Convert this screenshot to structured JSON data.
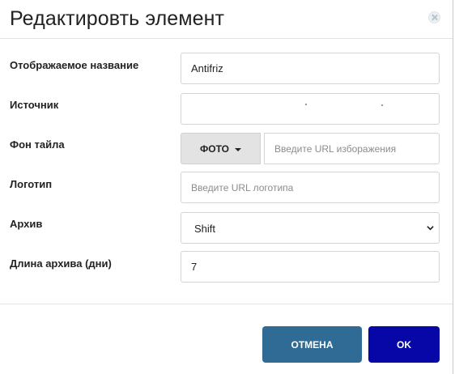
{
  "dialog": {
    "title": "Редактировть элемент"
  },
  "form": {
    "display_name": {
      "label": "Отображаемое название",
      "value": "Antifriz"
    },
    "source": {
      "label": "Источник",
      "value": ""
    },
    "tile_background": {
      "label": "Фон тайла",
      "type_button_label": "ФОТО",
      "url_placeholder": "Введите URL изборажения"
    },
    "logo": {
      "label": "Логотип",
      "placeholder": "Введите URL логотипа"
    },
    "archive": {
      "label": "Архив",
      "selected": "Shift"
    },
    "archive_length": {
      "label": "Длина архива (дни)",
      "value": "7"
    }
  },
  "footer": {
    "cancel_label": "ОТМЕНА",
    "ok_label": "OK"
  },
  "colors": {
    "cancel_button": "#2f6b94",
    "ok_button": "#0707a8"
  }
}
